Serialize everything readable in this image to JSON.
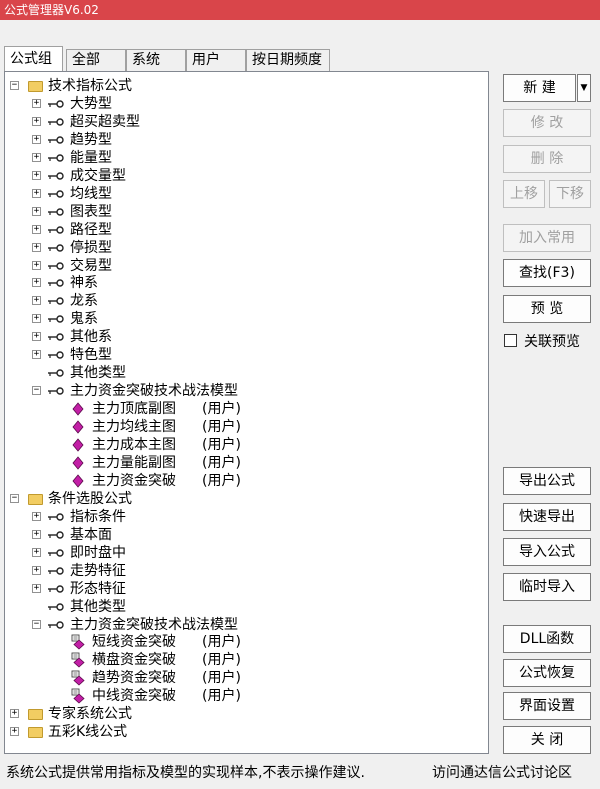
{
  "title": "公式管理器V6.02",
  "tabs": [
    "公式组",
    "全部",
    "系统",
    "用户",
    "按日期频度"
  ],
  "tree": [
    {
      "type": "folder",
      "label": "技术指标公式",
      "expander": "-"
    },
    {
      "type": "key",
      "label": "大势型",
      "expander": "+"
    },
    {
      "type": "key",
      "label": "超买超卖型",
      "expander": "+"
    },
    {
      "type": "key",
      "label": "趋势型",
      "expander": "+"
    },
    {
      "type": "key",
      "label": "能量型",
      "expander": "+"
    },
    {
      "type": "key",
      "label": "成交量型",
      "expander": "+"
    },
    {
      "type": "key",
      "label": "均线型",
      "expander": "+"
    },
    {
      "type": "key",
      "label": "图表型",
      "expander": "+"
    },
    {
      "type": "key",
      "label": "路径型",
      "expander": "+"
    },
    {
      "type": "key",
      "label": "停损型",
      "expander": "+"
    },
    {
      "type": "key",
      "label": "交易型",
      "expander": "+"
    },
    {
      "type": "key",
      "label": "神系",
      "expander": "+"
    },
    {
      "type": "key",
      "label": "龙系",
      "expander": "+"
    },
    {
      "type": "key",
      "label": "鬼系",
      "expander": "+"
    },
    {
      "type": "key",
      "label": "其他系",
      "expander": "+"
    },
    {
      "type": "key",
      "label": "特色型",
      "expander": "+"
    },
    {
      "type": "key",
      "label": "其他类型",
      "expander": ""
    },
    {
      "type": "key",
      "label": "主力资金突破技术战法模型",
      "expander": "-"
    },
    {
      "type": "diamond",
      "label": "主力顶底副图",
      "user": "(用户)"
    },
    {
      "type": "diamond",
      "label": "主力均线主图",
      "user": "(用户)"
    },
    {
      "type": "diamond",
      "label": "主力成本主图",
      "user": "(用户)"
    },
    {
      "type": "diamond",
      "label": "主力量能副图",
      "user": "(用户)"
    },
    {
      "type": "diamond",
      "label": "主力资金突破",
      "user": "(用户)"
    },
    {
      "type": "folder",
      "label": "条件选股公式",
      "expander": "-"
    },
    {
      "type": "key",
      "label": "指标条件",
      "expander": "+"
    },
    {
      "type": "key",
      "label": "基本面",
      "expander": "+"
    },
    {
      "type": "key",
      "label": "即时盘中",
      "expander": "+"
    },
    {
      "type": "key",
      "label": "走势特征",
      "expander": "+"
    },
    {
      "type": "key",
      "label": "形态特征",
      "expander": "+"
    },
    {
      "type": "key",
      "label": "其他类型",
      "expander": ""
    },
    {
      "type": "key",
      "label": "主力资金突破技术战法模型",
      "expander": "-"
    },
    {
      "type": "lock",
      "label": "短线资金突破",
      "user": "(用户)"
    },
    {
      "type": "lock",
      "label": "横盘资金突破",
      "user": "(用户)"
    },
    {
      "type": "lock",
      "label": "趋势资金突破",
      "user": "(用户)"
    },
    {
      "type": "lock",
      "label": "中线资金突破",
      "user": "(用户)"
    },
    {
      "type": "folder",
      "label": "专家系统公式",
      "expander": "+"
    },
    {
      "type": "folder",
      "label": "五彩K线公式",
      "expander": "+"
    }
  ],
  "buttons": {
    "new": "新 建",
    "new_arrow": "▼",
    "modify": "修 改",
    "delete": "删 除",
    "move_up": "上移",
    "move_down": "下移",
    "add_common": "加入常用",
    "find": "查找(F3)",
    "preview": "预 览",
    "link_preview": "关联预览",
    "export": "导出公式",
    "quick_export": "快速导出",
    "import": "导入公式",
    "temp_import": "临时导入",
    "dll": "DLL函数",
    "restore": "公式恢复",
    "ui_settings": "界面设置",
    "close": "关 闭"
  },
  "status": {
    "left": "系统公式提供常用指标及模型的实现样本,不表示操作建议.",
    "right": "访问通达信公式讨论区"
  },
  "colors": {
    "titlebar": "#d9454a",
    "diamond": "#c21fa6",
    "folder": "#f2cd62"
  }
}
